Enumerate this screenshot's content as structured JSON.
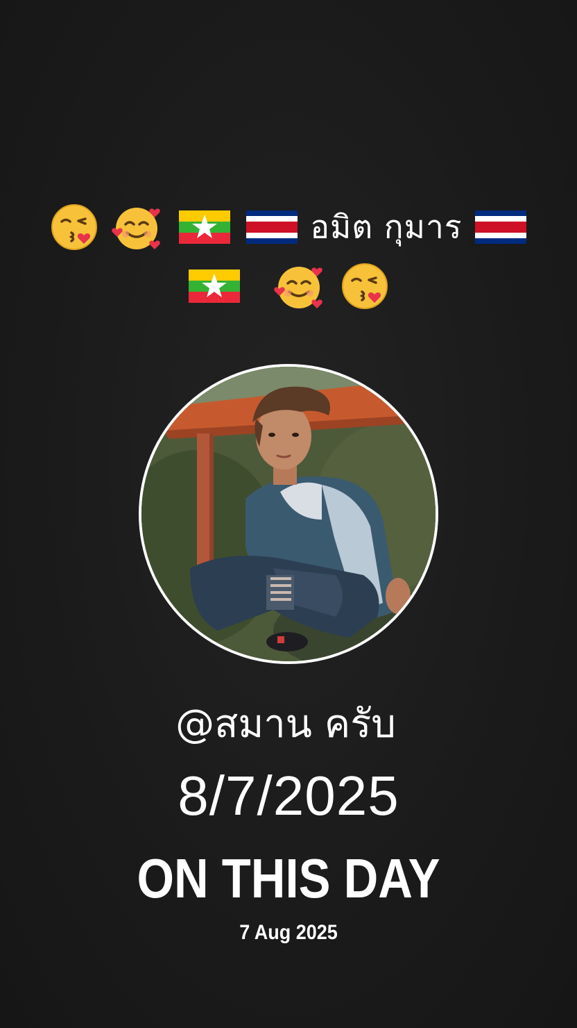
{
  "caption": {
    "line1_prefix_icons": [
      "kissing-face-emoji",
      "smiling-face-with-hearts-emoji",
      "myanmar-flag",
      "costa-rica-flag"
    ],
    "line1_text": "อมิต กุมาร",
    "line1_suffix_icons": [
      "costa-rica-flag"
    ],
    "line2_icons": [
      "myanmar-flag",
      "smiling-face-with-hearts-emoji",
      "kissing-face-emoji"
    ]
  },
  "profile": {
    "handle": "@สมาน ครับ",
    "date": "8/7/2025"
  },
  "memory": {
    "title": "ON THIS DAY",
    "date": "7 Aug 2025"
  },
  "colors": {
    "background": "#1c1c1c",
    "text": "#ffffff",
    "avatar_ring": "#ffffff"
  }
}
